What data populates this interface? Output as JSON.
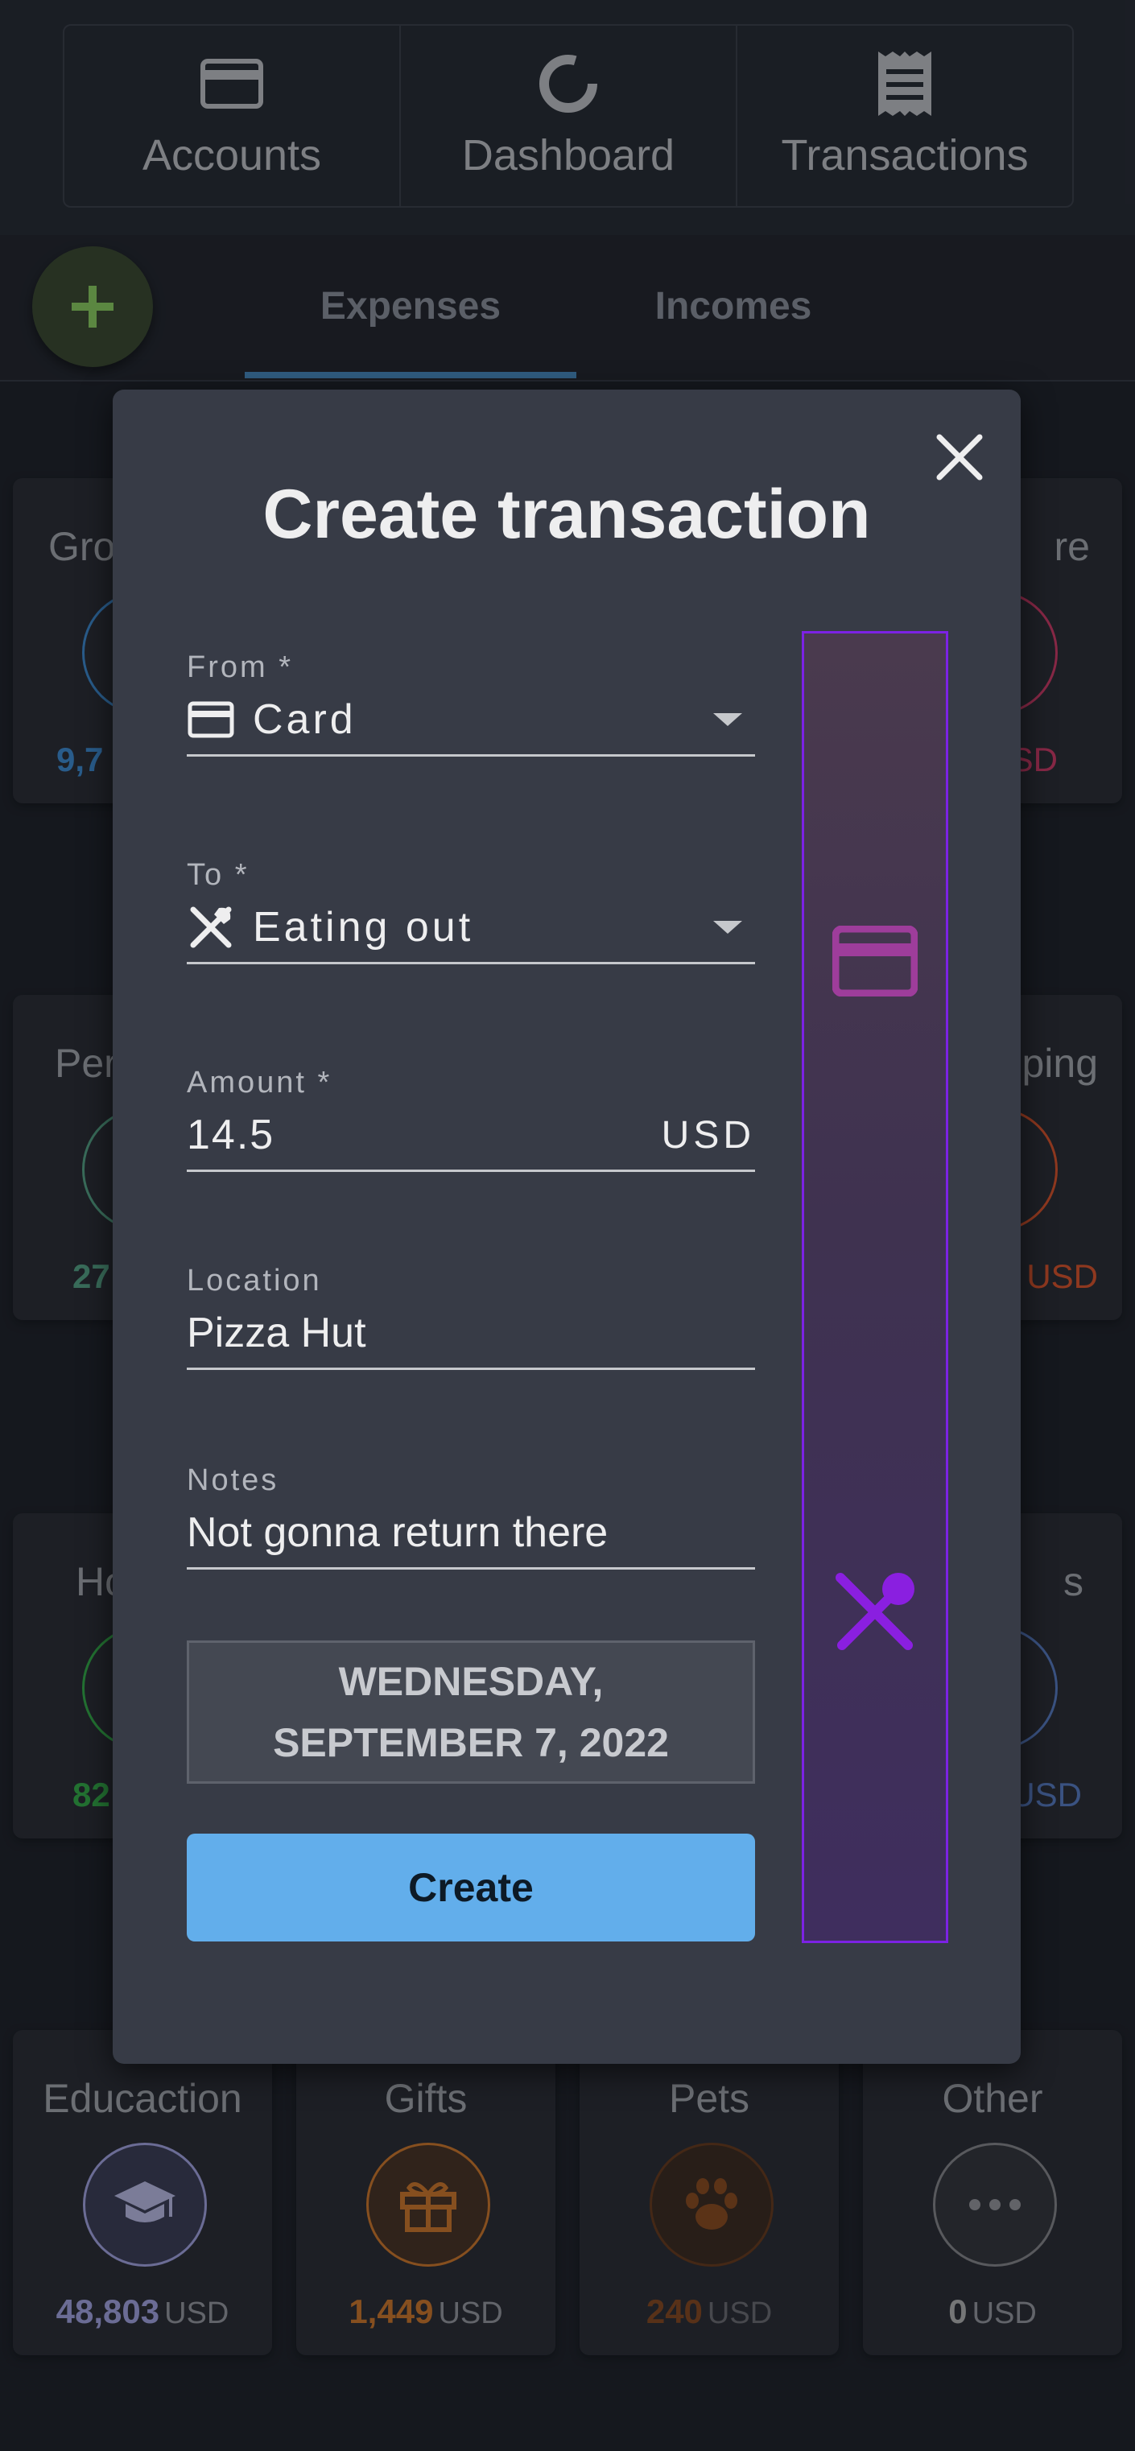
{
  "nav": {
    "items": [
      {
        "label": "Accounts",
        "icon": "credit-card-icon"
      },
      {
        "label": "Dashboard",
        "icon": "donut-chart-icon"
      },
      {
        "label": "Transactions",
        "icon": "receipt-icon"
      }
    ]
  },
  "tabs": {
    "expenses": "Expenses",
    "incomes": "Incomes",
    "active": "Expenses"
  },
  "add_button": {
    "icon": "plus-icon",
    "color": "#8ed461"
  },
  "background_cards": [
    {
      "label": "Gro",
      "amount": "9,7",
      "color": "#3e8ed8"
    },
    {
      "label": "re",
      "amount": "SD",
      "color": "#d63a6a"
    },
    {
      "label": "Per",
      "amount": "27",
      "color": "#58a88a"
    },
    {
      "label": "ping",
      "amount": "USD",
      "color": "#e0552a"
    },
    {
      "label": "Ho",
      "amount": "82",
      "color": "#34b24a"
    },
    {
      "label": "s",
      "amount": "USD",
      "color": "#5a7ec8"
    }
  ],
  "bottom_cards": [
    {
      "label": "Educaction",
      "amount": "48,803",
      "unit": "USD",
      "color": "#a8a8e8",
      "icon": "graduation-cap-icon"
    },
    {
      "label": "Gifts",
      "amount": "1,449",
      "unit": "USD",
      "color": "#d47a2a",
      "icon": "gift-icon"
    },
    {
      "label": "Pets",
      "amount": "240",
      "unit": "USD",
      "color": "#a0551f",
      "icon": "paw-icon"
    },
    {
      "label": "Other",
      "amount": "0",
      "unit": "USD",
      "color": "#b8b8b8",
      "icon": "more-icon"
    }
  ],
  "modal": {
    "title": "Create transaction",
    "close_icon": "close-icon",
    "from": {
      "label": "From *",
      "value": "Card",
      "icon": "credit-card-icon"
    },
    "to": {
      "label": "To *",
      "value": "Eating out",
      "icon": "fork-knife-icon"
    },
    "amount": {
      "label": "Amount *",
      "value": "14.5",
      "currency": "USD"
    },
    "location": {
      "label": "Location",
      "value": "Pizza Hut"
    },
    "notes": {
      "label": "Notes",
      "value": "Not gonna return there"
    },
    "date": "WEDNESDAY, SEPTEMBER 7, 2022",
    "submit": "Create",
    "accent_color": "#62aeeb",
    "flow": {
      "from_icon": "credit-card-icon",
      "to_icon": "fork-spoon-icon",
      "from_color": "#9e3d9b",
      "to_color": "#8a1fe0"
    }
  }
}
